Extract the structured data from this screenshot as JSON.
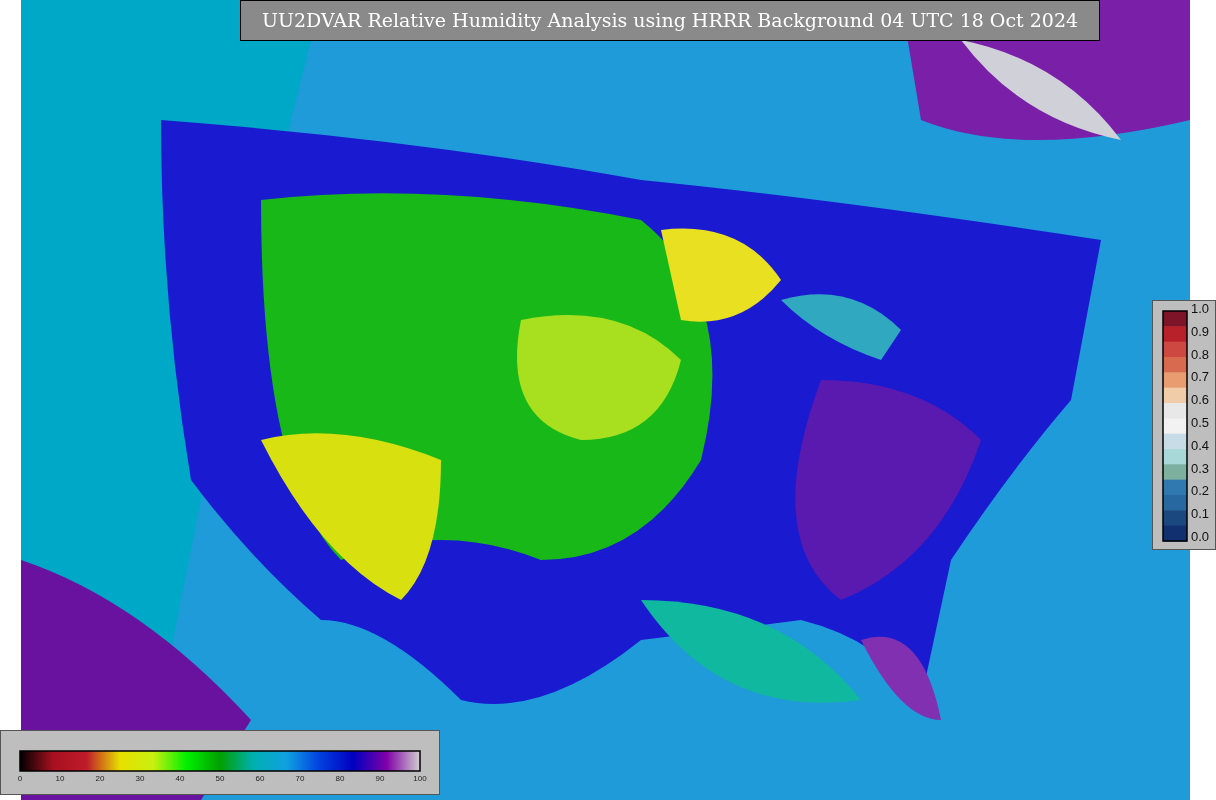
{
  "title": "UU2DVAR Relative Humidity Analysis using HRRR Background 04 UTC 18 Oct 2024",
  "percent_colorbar": {
    "ticks": [
      "0",
      "10",
      "20",
      "30",
      "40",
      "50",
      "60",
      "70",
      "80",
      "90",
      "100"
    ]
  },
  "fraction_colorbar": {
    "ticks": [
      "1.0",
      "0.9",
      "0.8",
      "0.7",
      "0.6",
      "0.5",
      "0.4",
      "0.3",
      "0.2",
      "0.1",
      "0.0"
    ]
  }
}
